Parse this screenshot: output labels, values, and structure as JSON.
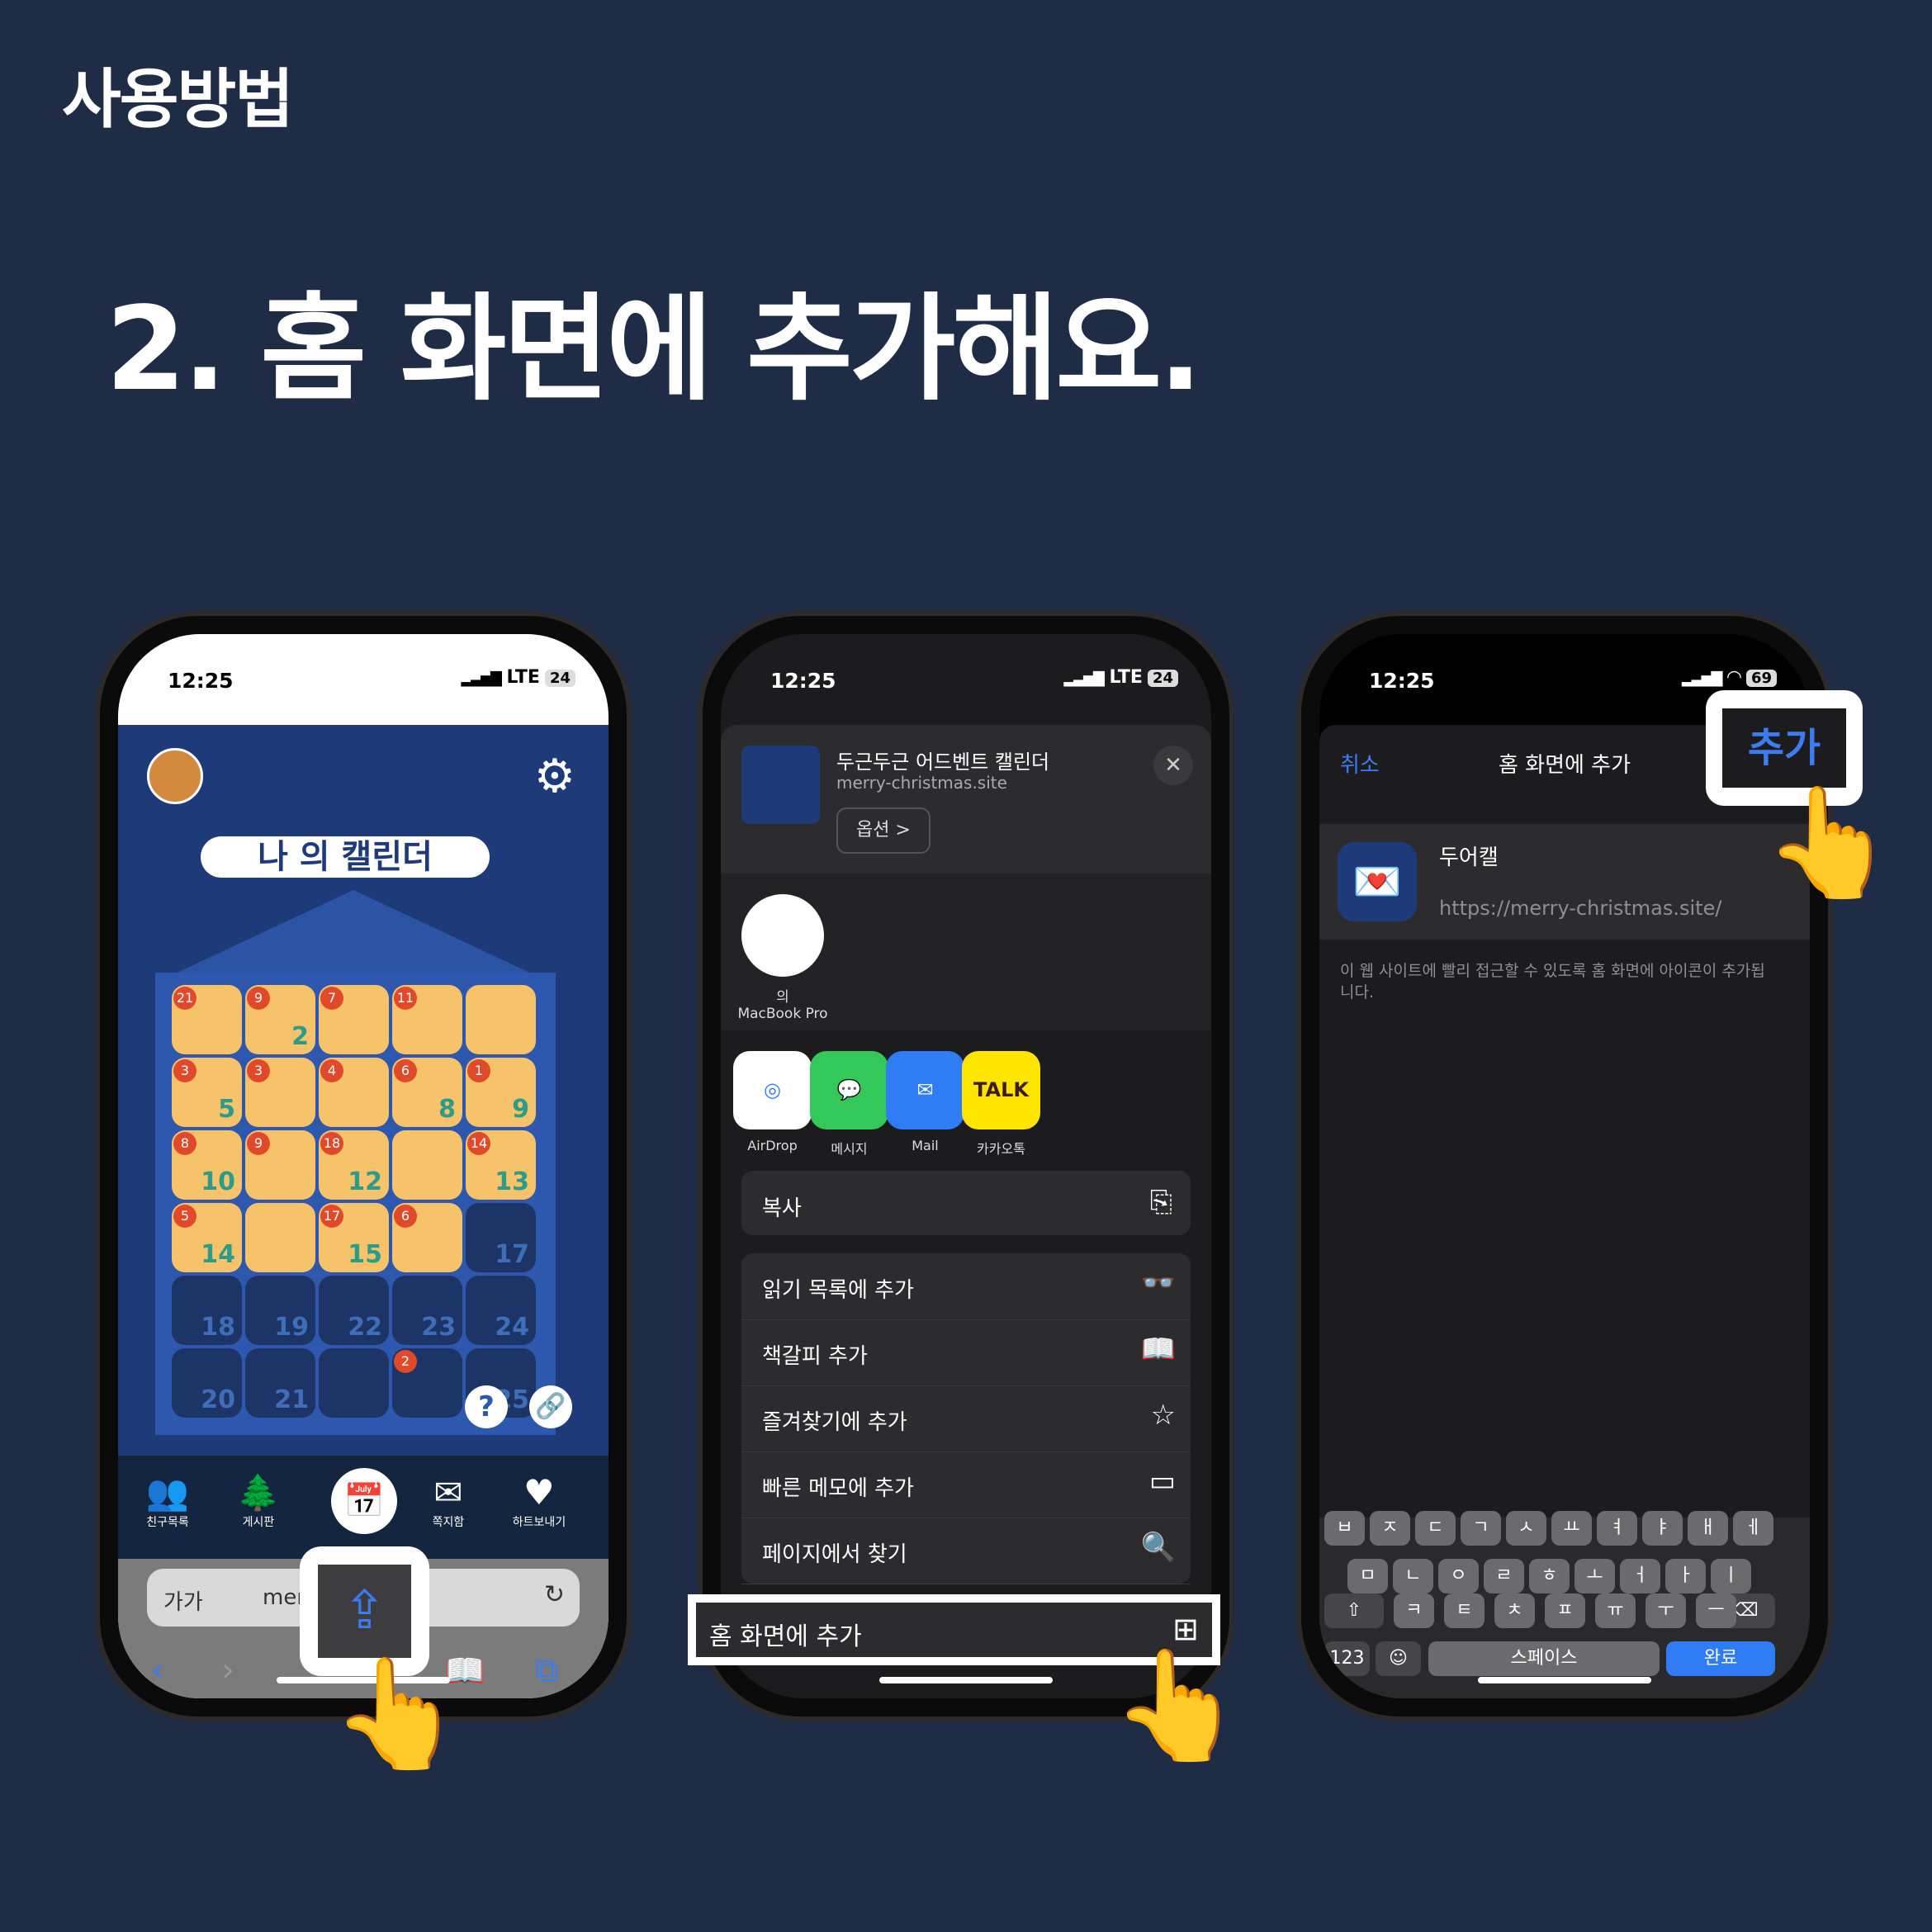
{
  "header": {
    "small_title": "사용방법",
    "big_title": "2. 홈 화면에 추가해요."
  },
  "status": {
    "time": "12:25",
    "network": "LTE",
    "battery": "24",
    "battery3": "69"
  },
  "phone1": {
    "calendar_title": "나 의 캘린더",
    "cells": [
      {
        "num": "",
        "badge": "21",
        "dark": false
      },
      {
        "num": "2",
        "badge": "9",
        "dark": false
      },
      {
        "num": "",
        "badge": "7",
        "dark": false
      },
      {
        "num": "",
        "badge": "11",
        "dark": false
      },
      {
        "num": "",
        "badge": "",
        "dark": false
      },
      {
        "num": "5",
        "badge": "3",
        "dark": false
      },
      {
        "num": "",
        "badge": "3",
        "dark": false
      },
      {
        "num": "",
        "badge": "4",
        "dark": false
      },
      {
        "num": "8",
        "badge": "6",
        "dark": false
      },
      {
        "num": "9",
        "badge": "1",
        "dark": false
      },
      {
        "num": "10",
        "badge": "8",
        "dark": false
      },
      {
        "num": "",
        "badge": "9",
        "dark": false
      },
      {
        "num": "12",
        "badge": "18",
        "dark": false
      },
      {
        "num": "",
        "badge": "",
        "dark": false
      },
      {
        "num": "13",
        "badge": "14",
        "dark": false
      },
      {
        "num": "14",
        "badge": "5",
        "dark": false
      },
      {
        "num": "",
        "badge": "",
        "dark": false
      },
      {
        "num": "15",
        "badge": "17",
        "dark": false
      },
      {
        "num": "",
        "badge": "6",
        "dark": false
      },
      {
        "num": "17",
        "badge": "",
        "dark": true
      },
      {
        "num": "18",
        "badge": "",
        "dark": true
      },
      {
        "num": "19",
        "badge": "",
        "dark": true
      },
      {
        "num": "22",
        "badge": "",
        "dark": true
      },
      {
        "num": "23",
        "badge": "",
        "dark": true
      },
      {
        "num": "24",
        "badge": "",
        "dark": true
      },
      {
        "num": "20",
        "badge": "",
        "dark": true
      },
      {
        "num": "21",
        "badge": "",
        "dark": true
      },
      {
        "num": "",
        "badge": "",
        "dark": true
      },
      {
        "num": "",
        "badge": "2",
        "dark": true
      },
      {
        "num": "25",
        "badge": "",
        "dark": true
      }
    ],
    "help_label": "?",
    "tabs": [
      "친구목록",
      "게시판",
      "쪽지함",
      "하트보내기"
    ],
    "url_aa": "가가",
    "url_text": "mer       .site"
  },
  "phone2": {
    "share_title": "두근두근 어드벤트 캘린더",
    "share_url": "merry-christmas.site",
    "options_label": "옵션 >",
    "airdrop_device_line1": "의",
    "airdrop_device_line2": "MacBook Pro",
    "apps": [
      "AirDrop",
      "메시지",
      "Mail",
      "카카오톡"
    ],
    "kakao_badge": "TALK",
    "copy_label": "복사",
    "actions": [
      "읽기 목록에 추가",
      "책갈피 추가",
      "즐겨찾기에 추가",
      "빠른 메모에 추가",
      "페이지에서 찾기"
    ],
    "add_home_label": "홈 화면에 추가"
  },
  "phone3": {
    "cancel_label": "취소",
    "title": "홈 화면에 추가",
    "add_label": "추가",
    "app_name": "두어캘",
    "app_url": "https://merry-christmas.site/",
    "note": "이 웹 사이트에 빨리 접근할 수 있도록 홈 화면에 아이콘이 추가됩니다.",
    "keys_row1": [
      "ㅂ",
      "ㅈ",
      "ㄷ",
      "ㄱ",
      "ㅅ",
      "ㅛ",
      "ㅕ",
      "ㅑ",
      "ㅐ",
      "ㅔ"
    ],
    "keys_row2": [
      "ㅁ",
      "ㄴ",
      "ㅇ",
      "ㄹ",
      "ㅎ",
      "ㅗ",
      "ㅓ",
      "ㅏ",
      "ㅣ"
    ],
    "keys_row3": [
      "ㅋ",
      "ㅌ",
      "ㅊ",
      "ㅍ",
      "ㅠ",
      "ㅜ",
      "ㅡ"
    ],
    "key_123": "123",
    "key_space": "스페이스",
    "key_done": "완료"
  },
  "icons": [
    "gear-icon",
    "share-icon",
    "close-icon",
    "copy-icon",
    "glasses-icon",
    "book-icon",
    "star-icon",
    "memo-icon",
    "find-icon",
    "plus-square-icon",
    "globe-icon",
    "mic-icon",
    "pointing-hand-icon"
  ]
}
